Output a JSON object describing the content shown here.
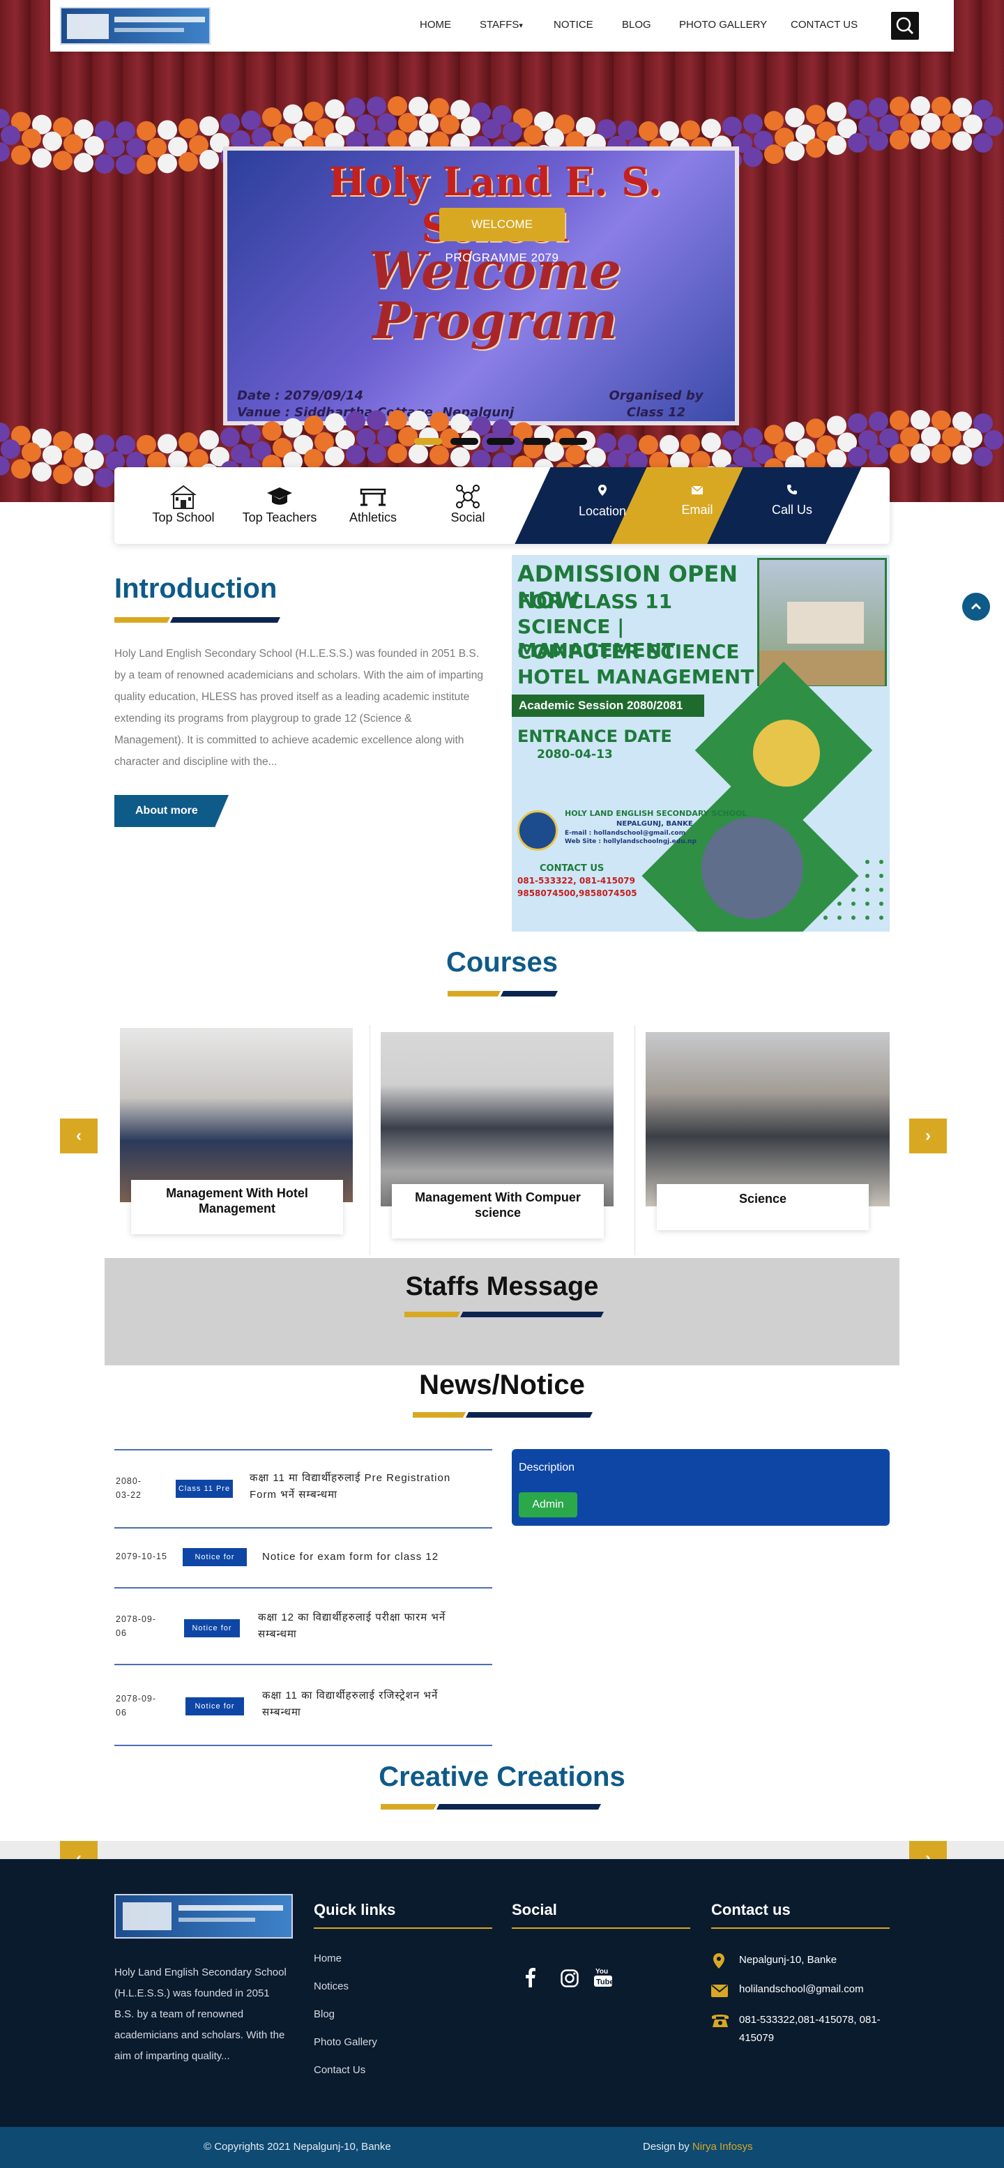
{
  "nav": {
    "items": [
      "HOME",
      "STAFFS",
      "NOTICE",
      "BLOG",
      "PHOTO GALLERY",
      "CONTACT US"
    ],
    "staffs_caret": "▾"
  },
  "hero": {
    "banner_title": "Holy Land E. S. School",
    "banner_welcome_1": "Welcome",
    "banner_welcome_2": "Program",
    "banner_date": "Date : 2079/09/14",
    "banner_venue": "Vanue : Siddhartha Cottage, Nepalgunj",
    "banner_org_1": "Organised by",
    "banner_org_2": "Class 12",
    "button": "WELCOME",
    "subtitle": "PROGRAMME 2079",
    "slide_count": 5,
    "active_slide": 0
  },
  "features": {
    "items": [
      {
        "label": "Top School",
        "icon": "school-icon"
      },
      {
        "label": "Top Teachers",
        "icon": "graduation-cap-icon"
      },
      {
        "label": "Athletics",
        "icon": "hurdle-icon"
      },
      {
        "label": "Social",
        "icon": "network-icon"
      }
    ],
    "contacts": [
      {
        "label": "Location",
        "icon": "map-pin-icon",
        "color": "#0c2450"
      },
      {
        "label": "Email",
        "icon": "envelope-icon",
        "color": "#d9a823"
      },
      {
        "label": "Call Us",
        "icon": "phone-icon",
        "color": "#0c2450"
      }
    ]
  },
  "intro": {
    "title": "Introduction",
    "text": "Holy Land English Secondary School (H.L.E.S.S.) was founded in 2051 B.S. by a team of renowned academicians and scholars. With the aim of imparting quality education, HLESS has proved itself as a leading academic institute extending its programs from playgroup to grade 12 (Science & Management). It is committed to achieve academic excellence along with character and discipline with the...",
    "button": "About more"
  },
  "poster": {
    "line1": "ADMISSION OPEN NOW",
    "line2": "FOR CLASS 11",
    "line3": "SCIENCE | MANAGEMENT",
    "line4": "COMPUTER SCIENCE",
    "line5": "HOTEL MANAGEMENT",
    "session": "Academic Session 2080/2081",
    "entrance": "ENTRANCE DATE",
    "entrance_date": "2080-04-13",
    "school": "HOLY LAND ENGLISH SECONDARY SCHOOL",
    "school_place": "NEPALGUNJ, BANKE",
    "email": "E-mail : hollandschool@gmail.com",
    "web": "Web Site : hollylandschoolngj.edu.np",
    "contact_title": "CONTACT US",
    "contact_1": "081-533322, 081-415079",
    "contact_2": "9858074500,9858074505"
  },
  "courses": {
    "title": "Courses",
    "items": [
      {
        "label": "Management With Hotel Management"
      },
      {
        "label": "Management With Compuer science"
      },
      {
        "label": "Science"
      }
    ],
    "prev": "‹",
    "next": "›"
  },
  "staff": {
    "title": "Staffs Message"
  },
  "news": {
    "title": "News/Notice",
    "items": [
      {
        "date": "2080-03-22",
        "tag": "Class 11 Pre",
        "title": "कक्षा 11 मा विद्यार्थीहरुलाई Pre Registration Form भर्ने सम्बन्धमा"
      },
      {
        "date": "2079-10-15",
        "tag": "Notice for",
        "title": "Notice for exam form for class 12"
      },
      {
        "date": "2078-09-06",
        "tag": "Notice for",
        "title": "कक्षा 12 का विद्यार्थीहरुलाई परीक्षा फारम भर्ने सम्बन्धमा"
      },
      {
        "date": "2078-09-06",
        "tag": "Notice for",
        "title": "कक्षा 11 का विद्यार्थीहरुलाई रजिस्ट्रेशन भर्ने सम्बन्धमा"
      }
    ],
    "description_label": "Description",
    "admin_button": "Admin"
  },
  "creative": {
    "title": "Creative Creations",
    "prev": "‹",
    "next": "›"
  },
  "footer": {
    "about": "Holy Land English Secondary School (H.L.E.S.S.) was founded in 2051 B.S. by a team of renowned academicians and scholars. With the aim of imparting quality...",
    "quick_title": "Quick links",
    "quick_links": [
      "Home",
      "Notices",
      "Blog",
      "Photo Gallery",
      "Contact Us"
    ],
    "social_title": "Social",
    "contact_title": "Contact us",
    "address": "Nepalgunj-10, Banke",
    "email": "holilandschool@gmail.com",
    "phone": "081-533322,081-415078, 081-415079",
    "copyright": "© Copyrights 2021 Nepalgunj-10, Banke",
    "design_by": "Design by",
    "designer": "Nirya Infosys"
  },
  "colors": {
    "gold": "#d9a823",
    "navy": "#0c2450",
    "blue": "#0e5a88",
    "notice_blue": "#0e46a6",
    "footer": "#0a1b2e"
  }
}
